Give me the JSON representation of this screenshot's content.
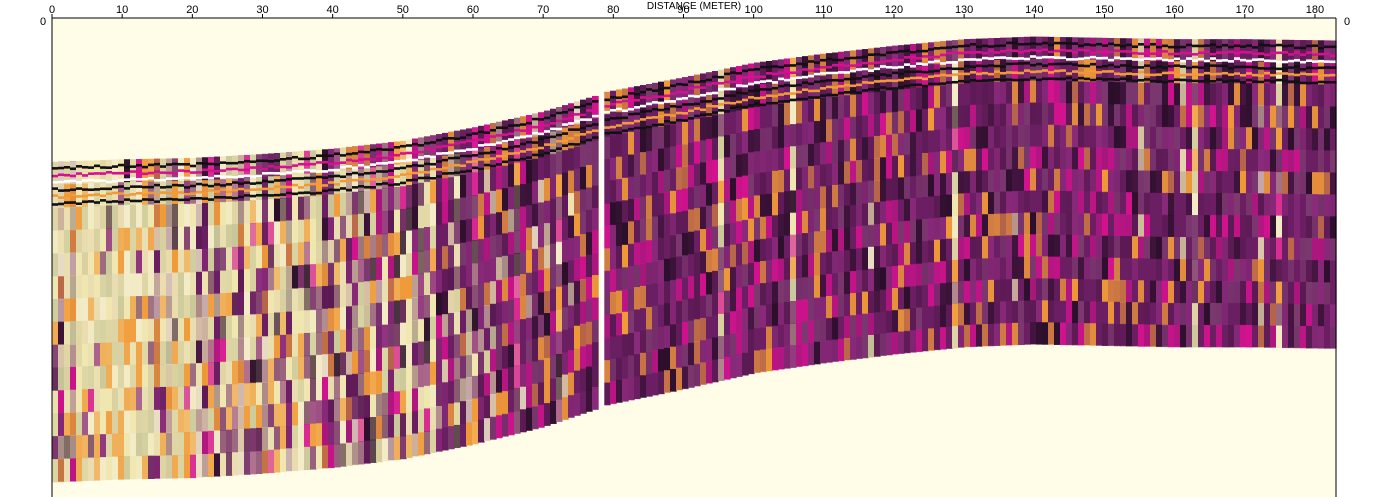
{
  "chart_data": {
    "type": "heatmap",
    "title": "",
    "xlabel": "DISTANCE (METER)",
    "ylabel": "",
    "xlim": [
      0,
      183
    ],
    "x_ticks": [
      0,
      10,
      20,
      30,
      40,
      50,
      60,
      70,
      80,
      90,
      100,
      110,
      120,
      130,
      140,
      150,
      160,
      170,
      180
    ],
    "left_y_tick": "0",
    "right_y_tick": "0",
    "surface_profile": {
      "x": [
        0,
        10,
        20,
        30,
        40,
        50,
        60,
        70,
        78,
        79,
        90,
        100,
        110,
        120,
        130,
        140,
        150,
        160,
        170,
        183
      ],
      "top_relative": [
        0.0,
        0.02,
        0.03,
        0.06,
        0.1,
        0.16,
        0.26,
        0.38,
        0.51,
        0.53,
        0.64,
        0.75,
        0.82,
        0.88,
        0.93,
        0.95,
        0.94,
        0.93,
        0.93,
        0.92
      ]
    },
    "colors": {
      "background": "#fffde8",
      "section_deep": "#6b1f63",
      "near_surface": "#f0e6b0",
      "magenta": "#d4128f",
      "black": "#111111",
      "orange": "#f09a38"
    }
  }
}
